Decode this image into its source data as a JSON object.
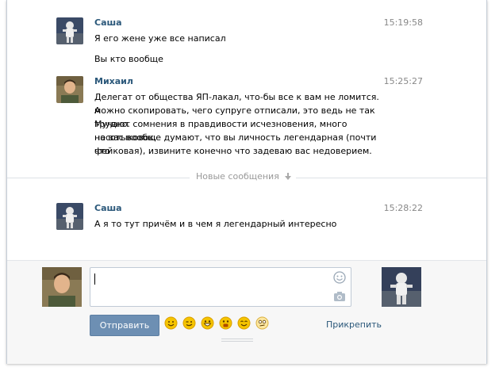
{
  "messages": [
    {
      "author": "Саша",
      "time": "15:19:58",
      "lines": [
        "Я его жене уже все написал"
      ],
      "extra": [
        "Вы кто вообще"
      ]
    },
    {
      "author": "Михаил",
      "time": "15:25:27",
      "lines": [
        "Делегат от общества ЯП-лакал, что-бы все к вам не ломится. А",
        "можно скопировать, чего супруге отписали, это ведь не так трудно.",
        "Мучают сомнения в правдивости исчезновения, много несотыковок,",
        "на вас вообще думают, что вы личность легендарная (почти что",
        "фейковая), извините конечно что задеваю вас недоверием."
      ]
    },
    {
      "author": "Саша",
      "time": "15:28:22",
      "lines": [
        "А я то тут причём и в чем я легендарный интересно"
      ]
    }
  ],
  "divider": {
    "label": "Новые сообщения",
    "icon": "arrow-down-icon"
  },
  "composer": {
    "value": "",
    "send_label": "Отправить",
    "attach_label": "Прикрепить",
    "emojis": [
      "smile-icon",
      "wink-icon",
      "grin-icon",
      "shocked-icon",
      "happy-icon",
      "confused-icon"
    ]
  },
  "colors": {
    "link": "#2b587a",
    "button": "#6d8fb3",
    "emoji": "#f5b800",
    "muted": "#888888"
  }
}
